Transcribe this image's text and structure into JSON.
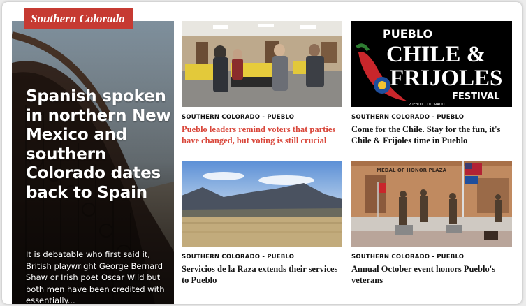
{
  "section": {
    "label": "Southern Colorado"
  },
  "featured": {
    "title": "Spanish spoken in northern New Mexico and southern Colorado dates back to Spain",
    "excerpt": "It is debatable who first said it, British playwright George Bernard Shaw or Irish poet Oscar Wild but both men have been credited with essentially..."
  },
  "cards": [
    {
      "kicker": "SOUTHERN COLORADO - PUEBLO",
      "headline": "Pueblo leaders remind voters that parties have changed, but voting is still crucial",
      "highlight": true
    },
    {
      "kicker": "SOUTHERN COLORADO - PUEBLO",
      "headline": "Come for the Chile. Stay for the fun, it's Chile & Frijoles time in Pueblo",
      "highlight": false
    },
    {
      "kicker": "SOUTHERN COLORADO - PUEBLO",
      "headline": "Servicios de la Raza extends their services to Pueblo",
      "highlight": false
    },
    {
      "kicker": "SOUTHERN COLORADO - PUEBLO",
      "headline": "Annual October event honors Pueblo's veterans",
      "highlight": false
    }
  ],
  "festival_logo": {
    "line1": "PUEBLO",
    "line2": "CHILE &",
    "line3": "FRIJOLES",
    "line4": "FESTIVAL",
    "small": "PUEBLO, COLORADO"
  },
  "plaza_sign": "MEDAL OF HONOR PLAZA",
  "colors": {
    "accent": "#c63a32",
    "headline_red": "#d9473b",
    "festival_bg": "#000000",
    "chile_red": "#c9262b",
    "chile_green": "#2e7d32"
  }
}
